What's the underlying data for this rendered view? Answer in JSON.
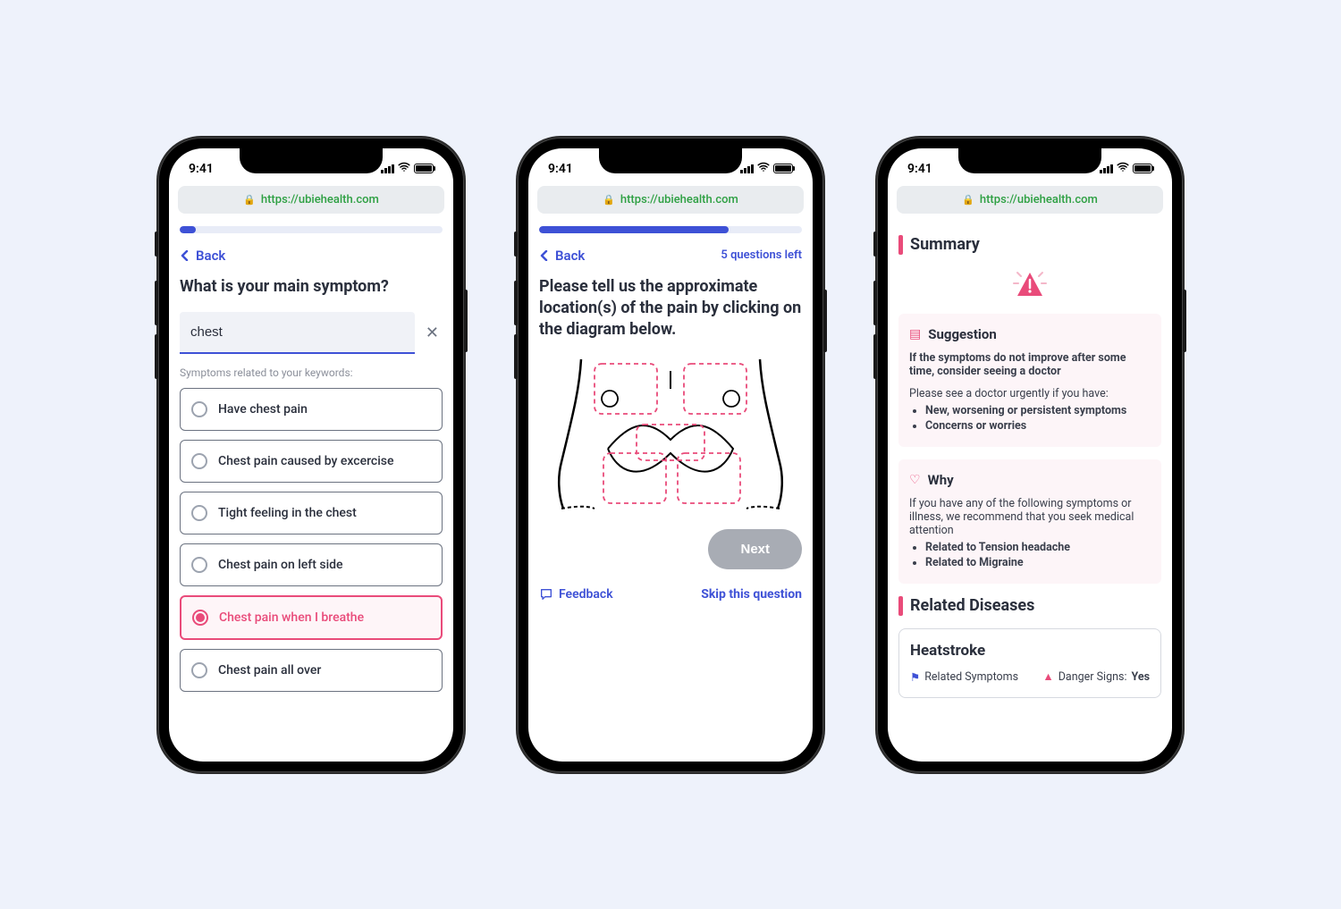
{
  "status": {
    "time": "9:41"
  },
  "browser": {
    "url": "https://ubiehealth.com"
  },
  "screen1": {
    "progress_pct": 6,
    "back_label": "Back",
    "title": "What is your main symptom?",
    "search_value": "chest",
    "related_label": "Symptoms related to your keywords:",
    "options": [
      "Have chest pain",
      "Chest pain caused by excercise",
      "Tight feeling in the chest",
      "Chest pain on left side",
      "Chest pain when I breathe",
      "Chest pain all over"
    ],
    "selected_index": 4
  },
  "screen2": {
    "progress_pct": 72,
    "back_label": "Back",
    "questions_left": "5 questions left",
    "title": "Please tell us the approximate location(s) of the pain by clicking on the diagram below.",
    "next_label": "Next",
    "feedback_label": "Feedback",
    "skip_label": "Skip this question"
  },
  "screen3": {
    "summary_title": "Summary",
    "suggestion": {
      "title": "Suggestion",
      "strong": "If the symptoms do not improve after some time, consider seeing a doctor",
      "lead": "Please see a doctor urgently if you have:",
      "bullets": [
        "New, worsening or persistent symptoms",
        "Concerns or worries"
      ]
    },
    "why": {
      "title": "Why",
      "lead": "If you have any of the following symptoms or illness, we recommend that you seek medical attention",
      "bullets": [
        "Related to Tension headache",
        "Related to Migraine"
      ]
    },
    "related_title": "Related Diseases",
    "disease": {
      "name": "Heatstroke",
      "related_symptoms_label": "Related Symptoms",
      "danger_label": "Danger Signs:",
      "danger_value": "Yes"
    }
  }
}
